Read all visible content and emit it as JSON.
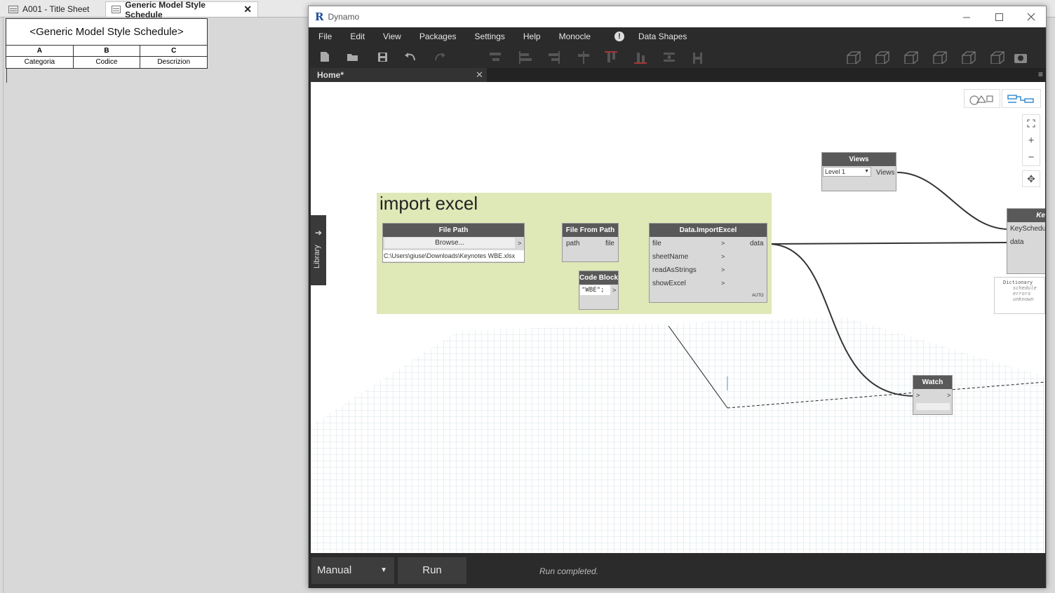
{
  "revit": {
    "tabs": [
      {
        "label": "A001 - Title Sheet"
      },
      {
        "label": "Generic Model Style Schedule",
        "close": "✕"
      }
    ],
    "schedule": {
      "title": "<Generic Model Style Schedule>",
      "letters": [
        "A",
        "B",
        "C"
      ],
      "headers": [
        "Categoria",
        "Codice",
        "Descrizion"
      ]
    }
  },
  "dynamo": {
    "window_title": "Dynamo",
    "menus": [
      "File",
      "Edit",
      "View",
      "Packages",
      "Settings",
      "Help",
      "Monocle",
      "Data Shapes"
    ],
    "tab": {
      "label": "Home*",
      "close": "✕"
    },
    "group_title": "import excel",
    "nodes": {
      "file_path": {
        "title": "File Path",
        "button": "Browse...",
        "value": "C:\\Users\\giuse\\Downloads\\Keynotes WBE.xlsx"
      },
      "file_from_path": {
        "title": "File From Path",
        "in": "path",
        "out": "file"
      },
      "code_block": {
        "title": "Code Block",
        "code": "\"WBE\";"
      },
      "import_excel": {
        "title": "Data.ImportExcel",
        "inputs": [
          "file",
          "sheetName",
          "readAsStrings",
          "showExcel"
        ],
        "out": "data",
        "lacing": "AUTO"
      },
      "views": {
        "title": "Views",
        "selected": "Level 1",
        "out": "Views"
      },
      "key_schedule": {
        "title": "Ke",
        "inputs": [
          "KeySchedu",
          "data"
        ]
      },
      "watch": {
        "title": "Watch"
      },
      "dictionary": {
        "label": "Dictionary",
        "keys": [
          "schedule",
          "errors",
          "unknown"
        ]
      }
    },
    "library_label": "Library",
    "run_mode": "Manual",
    "run_button": "Run",
    "status": "Run completed."
  }
}
